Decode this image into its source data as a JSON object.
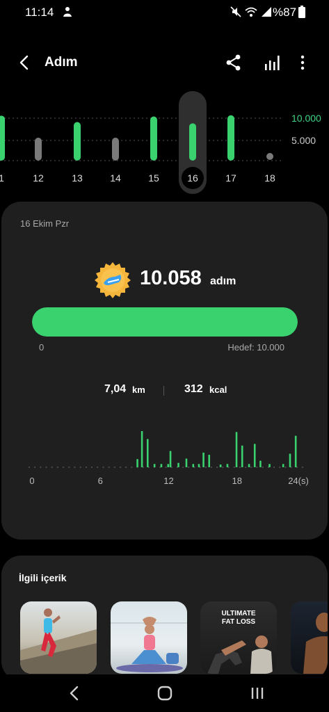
{
  "status": {
    "time": "11:14",
    "battery": "%87"
  },
  "header": {
    "title": "Adım"
  },
  "week": {
    "days": [
      "1",
      "12",
      "13",
      "14",
      "15",
      "16",
      "17",
      "18"
    ],
    "selected_day": "16",
    "goal_label": "10.000",
    "half_label": "5.000",
    "steps": [
      10600,
      5400,
      9100,
      5400,
      10400,
      8800,
      10700,
      0
    ],
    "goal_met": [
      true,
      false,
      true,
      false,
      true,
      true,
      true,
      false
    ],
    "goal": 10000
  },
  "day": {
    "date": "16 Ekim Pzr",
    "steps": "10.058",
    "steps_unit": "adım",
    "progress": 1.0,
    "progress_min": "0",
    "progress_goal": "Hedef: 10.000",
    "distance": "7,04",
    "distance_unit": "km",
    "calories": "312",
    "calories_unit": "kcal"
  },
  "chart_data": {
    "type": "bar",
    "x_ticks": [
      "0",
      "6",
      "12",
      "18",
      "24(s)"
    ],
    "x_range": [
      0,
      24
    ],
    "bars": [
      {
        "t": 9.5,
        "h": 0.15
      },
      {
        "t": 9.9,
        "h": 0.95
      },
      {
        "t": 10.4,
        "h": 0.52
      },
      {
        "t": 11.0,
        "h": 0.06
      },
      {
        "t": 11.6,
        "h": 0.06
      },
      {
        "t": 12.2,
        "h": 0.06
      },
      {
        "t": 12.4,
        "h": 0.3
      },
      {
        "t": 13.1,
        "h": 0.08
      },
      {
        "t": 13.8,
        "h": 0.16
      },
      {
        "t": 14.4,
        "h": 0.06
      },
      {
        "t": 14.9,
        "h": 0.06
      },
      {
        "t": 15.3,
        "h": 0.27
      },
      {
        "t": 15.8,
        "h": 0.23
      },
      {
        "t": 16.8,
        "h": 0.05
      },
      {
        "t": 17.4,
        "h": 0.06
      },
      {
        "t": 18.2,
        "h": 0.65
      },
      {
        "t": 18.7,
        "h": 0.4
      },
      {
        "t": 19.3,
        "h": 0.06
      },
      {
        "t": 19.8,
        "h": 0.43
      },
      {
        "t": 20.3,
        "h": 0.12
      },
      {
        "t": 21.1,
        "h": 0.06
      },
      {
        "t": 22.3,
        "h": 0.06
      },
      {
        "t": 22.9,
        "h": 0.25
      },
      {
        "t": 23.4,
        "h": 0.58
      }
    ]
  },
  "related": {
    "title": "İlgili içerik",
    "items": [
      {
        "caption": ""
      },
      {
        "caption": ""
      },
      {
        "caption": "ULTIMATE\nFAT LOSS"
      },
      {
        "caption": ""
      }
    ]
  },
  "icons": {
    "back": "back-arrow-icon",
    "share": "share-icon",
    "stats": "bar-chart-icon",
    "more": "more-vertical-icon"
  },
  "colors": {
    "accent": "#39d26f",
    "inactive_bar": "#7a7a7a",
    "card": "#1f1f1f"
  }
}
